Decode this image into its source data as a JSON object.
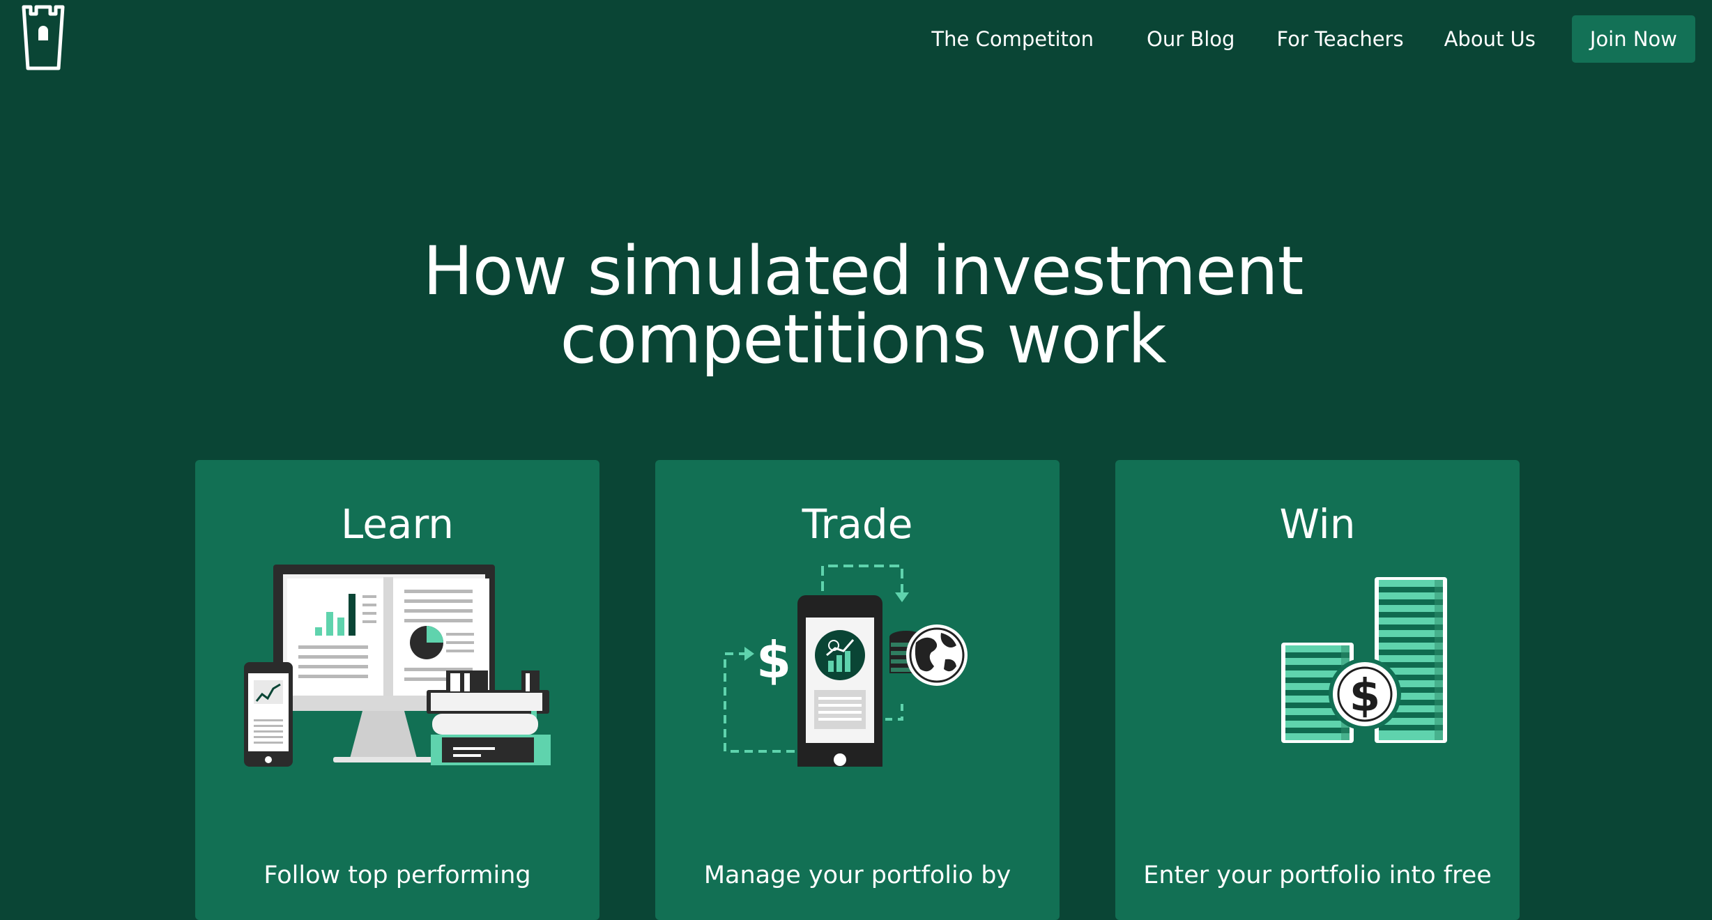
{
  "brand": {
    "logo_icon": "castle-tower-icon"
  },
  "nav": {
    "items": [
      {
        "label": "The Competiton"
      },
      {
        "label": "Our Blog"
      },
      {
        "label": "For Teachers"
      },
      {
        "label": "About Us"
      }
    ],
    "cta_label": "Join Now"
  },
  "hero": {
    "title_line1": "How simulated investment",
    "title_line2": "competitions work"
  },
  "cards": [
    {
      "title": "Learn",
      "text": "Follow top performing",
      "icon": "learn-devices-books-illustration"
    },
    {
      "title": "Trade",
      "text": "Manage your portfolio by",
      "icon": "trade-phone-dollar-globe-illustration"
    },
    {
      "title": "Win",
      "text": "Enter your portfolio into free",
      "icon": "win-coin-stacks-illustration"
    }
  ],
  "colors": {
    "background": "#0a4535",
    "card": "#127054",
    "button": "#137156",
    "accent": "#5fd3ad",
    "text": "#ffffff"
  }
}
